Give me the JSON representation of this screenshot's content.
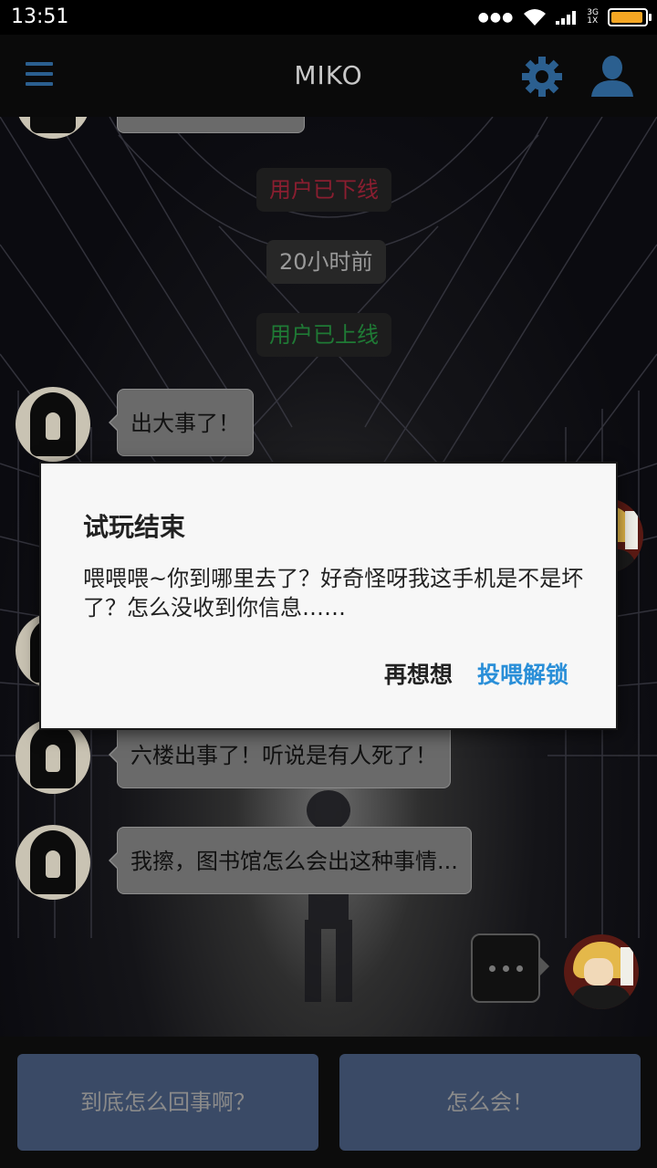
{
  "status_bar": {
    "time": "13:51",
    "network_top": "3G",
    "network_bottom": "1X",
    "battery_level": 0.95,
    "battery_color": "#f5a623"
  },
  "header": {
    "title": "MIKO",
    "menu_icon": "menu-icon",
    "settings_icon": "gear-icon",
    "profile_icon": "user-icon",
    "accent": "#2b5f8f"
  },
  "chat": {
    "system_offline": "用户已下线",
    "system_time": "20小时前",
    "system_online": "用户已上线",
    "messages": [
      "出大事了！",
      "六楼出事了！听说是有人死了！",
      "我擦，图书馆怎么会出这种事情..."
    ]
  },
  "dialog": {
    "title": "试玩结束",
    "message": "喂喂喂~你到哪里去了？好奇怪呀我这手机是不是坏了？怎么没收到你信息……",
    "cancel_label": "再想想",
    "confirm_label": "投喂解锁",
    "confirm_color": "#2a8fd8"
  },
  "replies": [
    "到底怎么回事啊？",
    "怎么会！"
  ]
}
